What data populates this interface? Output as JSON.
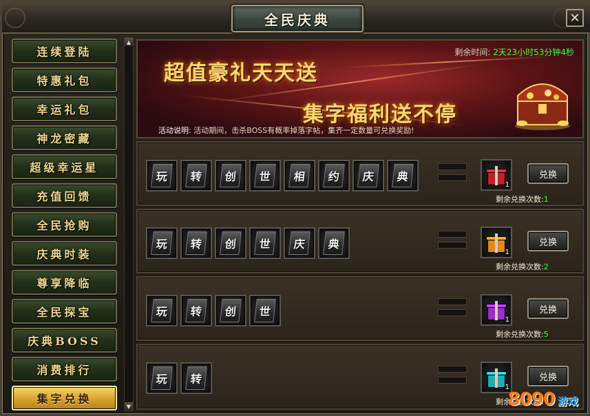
{
  "window": {
    "title": "全民庆典",
    "close_label": "✕"
  },
  "sidebar": {
    "items": [
      {
        "label": "连续登陆",
        "active": false
      },
      {
        "label": "特惠礼包",
        "active": false
      },
      {
        "label": "幸运礼包",
        "active": false
      },
      {
        "label": "神龙密藏",
        "active": false
      },
      {
        "label": "超级幸运星",
        "active": false
      },
      {
        "label": "充值回馈",
        "active": false
      },
      {
        "label": "全民抢购",
        "active": false
      },
      {
        "label": "庆典时装",
        "active": false
      },
      {
        "label": "尊享降临",
        "active": false
      },
      {
        "label": "全民探宝",
        "active": false
      },
      {
        "label": "庆典BOSS",
        "active": false
      },
      {
        "label": "消费排行",
        "active": false
      },
      {
        "label": "集字兑换",
        "active": true
      }
    ]
  },
  "banner": {
    "title_line1": "超值豪礼天天送",
    "title_line2": "集字福利送不停",
    "countdown_label": "剩余时间:",
    "countdown_value": "2天23小时53分钟4秒",
    "description_label": "活动说明:",
    "description_text": "活动期间，击杀BOSS有概率掉落字帖，集齐一定数量可兑换奖励!"
  },
  "exchange_rows": [
    {
      "chars": [
        "玩",
        "转",
        "创",
        "世",
        "相",
        "约",
        "庆",
        "典"
      ],
      "reward_qty": "1",
      "reward_color": "#c0202a",
      "button_label": "兑换",
      "remaining_label": "剩余兑换次数:",
      "remaining_value": "1"
    },
    {
      "chars": [
        "玩",
        "转",
        "创",
        "世",
        "庆",
        "典"
      ],
      "reward_qty": "1",
      "reward_color": "#e08a18",
      "button_label": "兑换",
      "remaining_label": "剩余兑换次数:",
      "remaining_value": "2"
    },
    {
      "chars": [
        "玩",
        "转",
        "创",
        "世"
      ],
      "reward_qty": "1",
      "reward_color": "#9a30c8",
      "button_label": "兑换",
      "remaining_label": "剩余兑换次数:",
      "remaining_value": "5"
    },
    {
      "chars": [
        "玩",
        "转"
      ],
      "reward_qty": "1",
      "reward_color": "#2aa8b0",
      "button_label": "兑换",
      "remaining_label": "剩余兑换次数:",
      "remaining_value": ""
    }
  ],
  "watermark": {
    "text": "8090",
    "suffix": "游戏"
  }
}
